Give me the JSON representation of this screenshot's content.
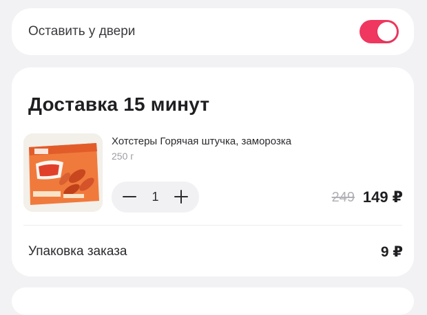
{
  "leave_at_door": {
    "label": "Оставить у двери",
    "enabled": true,
    "accent_color": "#f0375f"
  },
  "delivery": {
    "title": "Доставка 15 минут",
    "product": {
      "name": "Хотстеры Горячая штучка, заморозка",
      "weight": "250 г",
      "image_icon": "hotsters-package-image",
      "quantity": "1",
      "price_old": "249",
      "price_new": "149 ₽"
    },
    "packaging": {
      "label": "Упаковка заказа",
      "price": "9 ₽"
    }
  }
}
